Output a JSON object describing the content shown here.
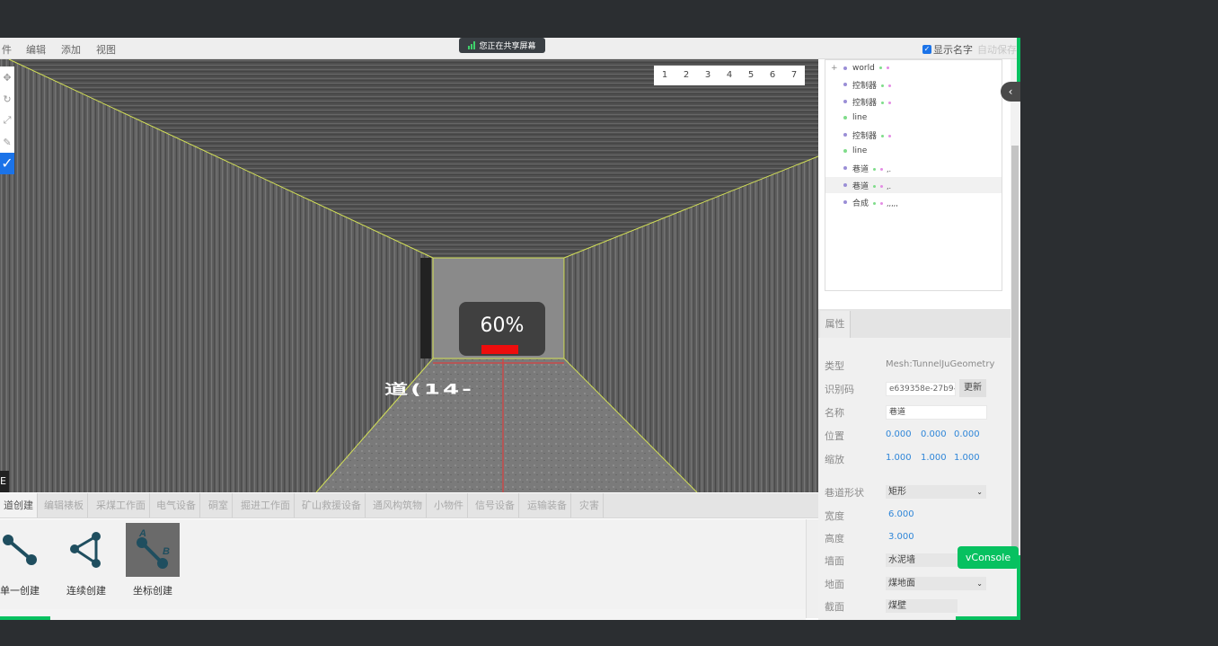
{
  "menu": {
    "items": [
      "件",
      "编辑",
      "添加",
      "视图"
    ]
  },
  "share": {
    "label": "您正在共享屏幕"
  },
  "topright": {
    "show_names_label": "显示名字",
    "autosave_label": "自动保存"
  },
  "viewport": {
    "tabs": [
      "1",
      "2",
      "3",
      "4",
      "5",
      "6",
      "7"
    ],
    "progress_label": "60%",
    "progress_value": 0.6,
    "floating_text": "道(14-",
    "corner_label": "E"
  },
  "left_tools": [
    "move-icon",
    "rotate-icon",
    "scale-icon",
    "ruler-icon"
  ],
  "categories": [
    "道创建",
    "编辑裱板",
    "采煤工作面",
    "电气设备",
    "硐室",
    "掘进工作面",
    "矿山救援设备",
    "通风构筑物",
    "小物件",
    "信号设备",
    "运输装备",
    "灾害"
  ],
  "tools": [
    {
      "label": "单一创建",
      "icon": "single-create-icon"
    },
    {
      "label": "连续创建",
      "icon": "continuous-create-icon"
    },
    {
      "label": "坐标创建",
      "icon": "coordinate-create-icon"
    }
  ],
  "outliner": {
    "nodes": [
      {
        "name": "world",
        "tail": "",
        "marks": true,
        "plus": "+"
      },
      {
        "name": "控制器",
        "tail": "",
        "marks": true,
        "plus": ""
      },
      {
        "name": "控制器",
        "tail": "",
        "marks": true,
        "plus": ""
      },
      {
        "name": "line",
        "tail": "",
        "marks": false,
        "plus": ""
      },
      {
        "name": "控制器",
        "tail": "",
        "marks": true,
        "plus": ""
      },
      {
        "name": "line",
        "tail": "",
        "marks": false,
        "plus": ""
      },
      {
        "name": "巷道",
        "tail": ",.",
        "marks": true,
        "plus": ""
      },
      {
        "name": "巷道",
        "tail": ",.",
        "marks": true,
        "plus": ""
      },
      {
        "name": "合成",
        "tail": ",,,,,",
        "marks": true,
        "plus": ""
      }
    ]
  },
  "properties": {
    "tab": "属性",
    "type_label": "类型",
    "type_value": "Mesh:TunnelJuGeometry",
    "uuid_label": "识别码",
    "uuid_value": "e639358e-27b9-4",
    "update_btn": "更新",
    "name_label": "名称",
    "name_value": "巷道",
    "position_label": "位置",
    "position": [
      "0.000",
      "0.000",
      "0.000"
    ],
    "scale_label": "缩放",
    "scale": [
      "1.000",
      "1.000",
      "1.000"
    ],
    "shape_label": "巷道形状",
    "shape_value": "矩形",
    "width_label": "宽度",
    "width_value": "6.000",
    "height_label": "高度",
    "height_value": "3.000",
    "wall_label": "墙面",
    "wall_value": "水泥墙",
    "ground_label": "地面",
    "ground_value": "煤地面",
    "section_label": "截面",
    "section_value": "煤壁"
  },
  "vconsole": {
    "label": "vConsole"
  },
  "colors": {
    "accent": "#1b73e8",
    "progress": "#ee0d0d",
    "vconsole": "#07c160",
    "edge": "#d4e157"
  }
}
